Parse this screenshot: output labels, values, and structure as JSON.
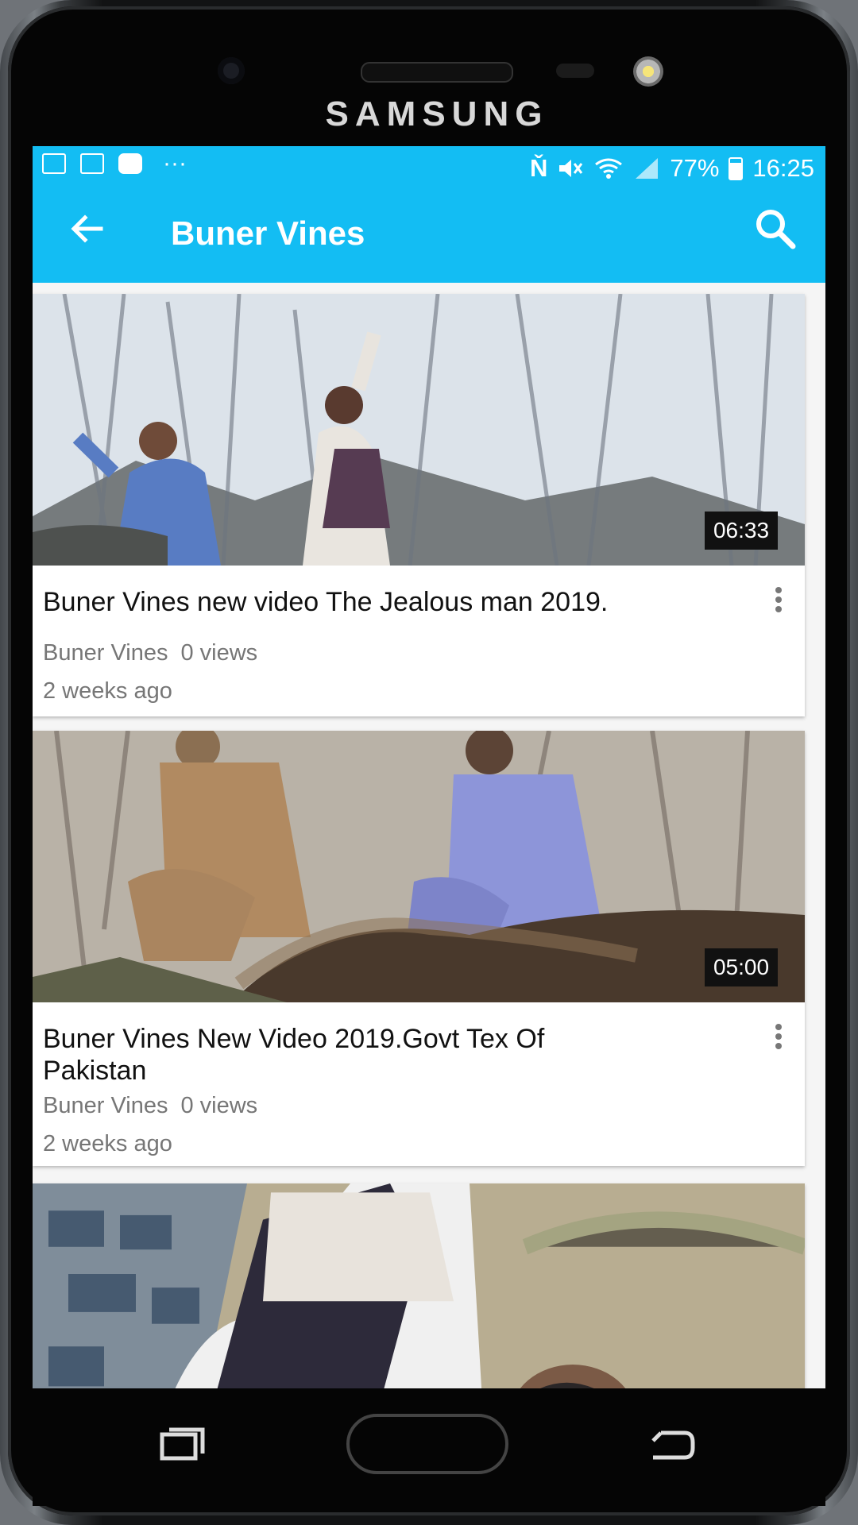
{
  "device": {
    "brand": "SAMSUNG"
  },
  "status_bar": {
    "battery": "77%",
    "time": "16:25",
    "more": "···"
  },
  "toolbar": {
    "title": "Buner Vines"
  },
  "videos": [
    {
      "duration": "06:33",
      "title": "Buner Vines new video The Jealous man 2019.",
      "channel": "Buner Vines",
      "views": "0 views",
      "age": "2 weeks ago"
    },
    {
      "duration": "05:00",
      "title": "Buner Vines New Video 2019.Govt Tex Of Pakistan",
      "channel": "Buner Vines",
      "views": "0 views",
      "age": "2 weeks ago"
    }
  ],
  "icons": {
    "back": "back-arrow-icon",
    "search": "search-icon",
    "more": "more-vertical-icon",
    "status": [
      "image-icon",
      "tv-icon",
      "youtube-icon",
      "nfc-icon",
      "mute-icon",
      "wifi-icon",
      "signal-icon",
      "battery-icon"
    ],
    "navigation": [
      "recent-apps-icon",
      "home-button",
      "back-icon"
    ]
  },
  "colors": {
    "accent": "#13bdf3",
    "duration_badge": "#111111",
    "secondary_text": "#767676"
  }
}
